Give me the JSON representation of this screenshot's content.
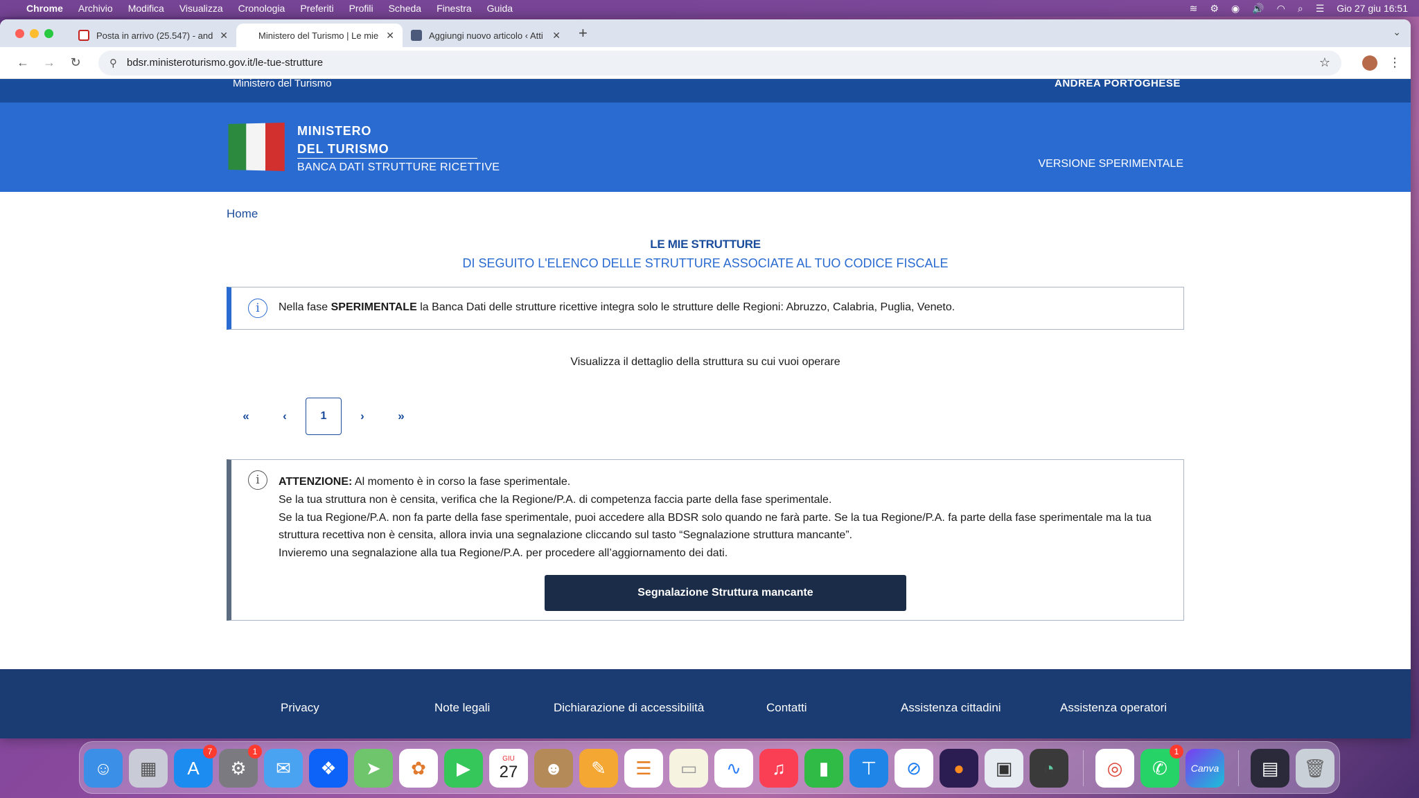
{
  "menubar": {
    "app": "Chrome",
    "items": [
      "Archivio",
      "Modifica",
      "Visualizza",
      "Cronologia",
      "Preferiti",
      "Profili",
      "Scheda",
      "Finestra",
      "Guida"
    ],
    "clock": "Gio 27 giu  16:51"
  },
  "tabs": [
    {
      "title": "Posta in arrivo (25.547) - and",
      "favicon_color": "#c5221f"
    },
    {
      "title": "Ministero del Turismo | Le mie",
      "favicon_color": "#ffffff"
    },
    {
      "title": "Aggiungi nuovo articolo ‹ Atti",
      "favicon_color": "#4b5a7a"
    }
  ],
  "toolbar": {
    "url": "bdsr.ministeroturismo.gov.it/le-tue-strutture"
  },
  "site": {
    "slim_header_left": "Ministero del Turismo",
    "slim_header_user": "ANDREA PORTOGHESE",
    "brand_line1": "MINISTERO",
    "brand_line2": "DEL TURISMO",
    "brand_line3": "BANCA DATI STRUTTURE RICETTIVE",
    "version": "VERSIONE SPERIMENTALE"
  },
  "main": {
    "breadcrumb": "Home",
    "title": "LE MIE STRUTTURE",
    "subtitle": "DI SEGUITO L'ELENCO DELLE STRUTTURE ASSOCIATE AL TUO CODICE FISCALE",
    "info_prefix": "Nella fase ",
    "info_bold": "SPERIMENTALE",
    "info_suffix": " la Banca Dati delle strutture ricettive integra solo le strutture delle Regioni: Abruzzo, Calabria, Puglia, Veneto.",
    "detail_prompt": "Visualizza il dettaglio della struttura su cui vuoi operare",
    "pagination": {
      "first": "«",
      "prev": "‹",
      "current": "1",
      "next": "›",
      "last": "»"
    },
    "warning": {
      "label": "ATTENZIONE:",
      "line1": " Al momento è in corso la fase sperimentale.",
      "line2": "Se la tua struttura non è censita, verifica che la Regione/P.A. di competenza faccia parte della fase sperimentale.",
      "line3": "Se la tua Regione/P.A. non fa parte della fase sperimentale, puoi accedere alla BDSR solo quando ne farà parte. Se la tua Regione/P.A. fa parte della fase sperimentale ma la tua struttura recettiva non è censita, allora invia una segnalazione cliccando sul tasto “Segnalazione struttura mancante”.",
      "line4": "Invieremo una segnalazione alla tua Regione/P.A. per procedere all’aggiornamento dei dati."
    },
    "report_button": "Segnalazione Struttura mancante"
  },
  "footer": {
    "links": [
      "Privacy",
      "Note legali",
      "Dichiarazione di accessibilità",
      "Contatti",
      "Assistenza cittadini",
      "Assistenza operatori"
    ]
  },
  "dock": {
    "appstore_badge": "7",
    "settings_badge": "1",
    "calendar_month": "GIU",
    "calendar_day": "27",
    "whatsapp_badge": "1",
    "canva_label": "Canva"
  }
}
